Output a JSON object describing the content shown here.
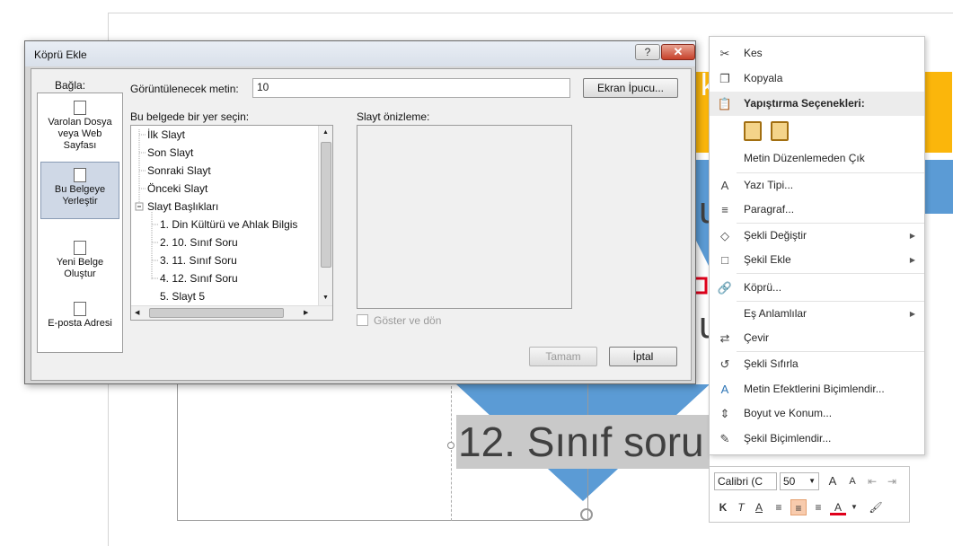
{
  "background": {
    "slide_text": "12. Sınıf soru",
    "peek_letter_1": "k",
    "peek_letter_2": "u",
    "peek_letter_3": "u"
  },
  "dialog": {
    "title": "Köprü Ekle",
    "help_label": "?",
    "close_label": "✕",
    "link_to_label": "Bağla:",
    "display_text_label": "Görüntülenecek metin:",
    "display_text_value": "10",
    "screentip_button": "Ekran İpucu...",
    "place_label": "Bu belgede bir yer seçin:",
    "preview_label": "Slayt önizleme:",
    "link_options": [
      {
        "label": "Varolan Dosya veya Web Sayfası",
        "icon": "existing-file-icon"
      },
      {
        "label": "Bu Belgeye Yerleştir",
        "icon": "place-in-document-icon"
      },
      {
        "label": "Yeni Belge Oluştur",
        "icon": "new-document-icon"
      },
      {
        "label": "E-posta Adresi",
        "icon": "email-address-icon"
      }
    ],
    "tree_items": [
      "İlk Slayt",
      "Son Slayt",
      "Sonraki Slayt",
      "Önceki Slayt",
      "Slayt Başlıkları",
      "1.  Din Kültürü ve Ahlak Bilgis",
      "2. 10. Sınıf Soru",
      "3. 11. Sınıf Soru",
      "4. 12. Sınıf Soru",
      "5. Slayt 5"
    ],
    "show_and_return_label": "Göster ve dön",
    "ok_button": "Tamam",
    "cancel_button": "İptal"
  },
  "context_menu": {
    "items": [
      {
        "label": "Kes",
        "icon": "scissors-icon"
      },
      {
        "label": "Kopyala",
        "icon": "copy-icon"
      },
      {
        "label": "Yapıştırma Seçenekleri:",
        "icon": "paste-icon"
      },
      {
        "label": "Metin Düzenlemeden Çık"
      },
      {
        "label": "Yazı Tipi...",
        "icon": "font-icon"
      },
      {
        "label": "Paragraf...",
        "icon": "paragraph-icon"
      },
      {
        "label": "Şekli Değiştir",
        "icon": "change-shape-icon"
      },
      {
        "label": "Şekil Ekle",
        "icon": "add-shape-icon"
      },
      {
        "label": "Köprü...",
        "icon": "hyperlink-icon"
      },
      {
        "label": "Eş Anlamlılar"
      },
      {
        "label": "Çevir",
        "icon": "translate-icon"
      },
      {
        "label": "Şekli Sıfırla",
        "icon": "reset-shape-icon"
      },
      {
        "label": "Metin Efektlerini Biçimlendir...",
        "icon": "text-effects-icon"
      },
      {
        "label": "Boyut ve Konum...",
        "icon": "size-position-icon"
      },
      {
        "label": "Şekil Biçimlendir...",
        "icon": "format-shape-icon"
      }
    ]
  },
  "mini_toolbar": {
    "font_name": "Calibri (C",
    "font_size": "50",
    "bold": "K",
    "italic": "T",
    "underline": "A",
    "font_color": "A"
  },
  "colors": {
    "accent_orange": "#fbb60b",
    "accent_blue": "#5b9bd5",
    "arrow_red": "#e0001b",
    "close_red": "#c7412a"
  }
}
